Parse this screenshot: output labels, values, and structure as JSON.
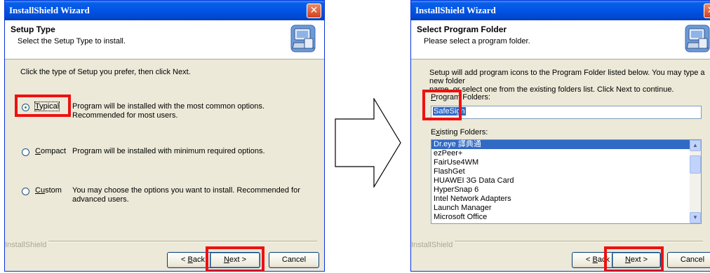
{
  "dialog1": {
    "title": "InstallShield Wizard",
    "close_glyph": "✕",
    "header_title": "Setup Type",
    "header_subtitle": "Select the Setup Type to install.",
    "instruction": "Click the type of Setup you prefer, then click Next.",
    "options": [
      {
        "label_first": "T",
        "label_rest": "ypical",
        "checked": true,
        "description": "Program will be installed with the most common options.  Recommended for most users."
      },
      {
        "label_first": "C",
        "label_rest": "ompact",
        "checked": false,
        "description": "Program will be installed with minimum required options."
      },
      {
        "label_first": "Cu",
        "label_rest": "stom",
        "checked": false,
        "description": "You may choose the options you want to install. Recommended for advanced users."
      }
    ],
    "brand": "InstallShield",
    "buttons": {
      "back_prefix": "< ",
      "back_first": "B",
      "back_rest": "ack",
      "next_first": "N",
      "next_rest": "ext >",
      "cancel": "Cancel"
    }
  },
  "dialog2": {
    "title": "InstallShield Wizard",
    "close_glyph": "✕",
    "header_title": "Select Program Folder",
    "header_subtitle": "Please select a program folder.",
    "instruction_line1": "Setup will add program icons to the Program Folder listed below.  You may type a new folder",
    "instruction_line2": "name, or select one from the existing folders list.  Click Next to continue.",
    "program_folders_label_first": "P",
    "program_folders_label_rest": "rogram Folders:",
    "program_folder_value": "SafeSign",
    "existing_folders_label_first": "E",
    "existing_folders_label_x": "x",
    "existing_folders_label_rest": "isting Folders:",
    "folders": [
      "Dr.eye 譯典通",
      "ezPeer+",
      "FairUse4WM",
      "FlashGet",
      "HUAWEI 3G Data Card",
      "HyperSnap 6",
      "Intel Network Adapters",
      "Launch Manager",
      "Microsoft Office"
    ],
    "brand": "InstallShield",
    "buttons": {
      "back_prefix": "< ",
      "back_first": "B",
      "back_rest": "ack",
      "next_first": "N",
      "next_rest": "ext >",
      "cancel": "Cancel"
    }
  },
  "colors": {
    "titlebar": "#0055e5",
    "highlight": "#ee1111",
    "selection": "#316ac5",
    "dialog_bg": "#ece9d8"
  }
}
